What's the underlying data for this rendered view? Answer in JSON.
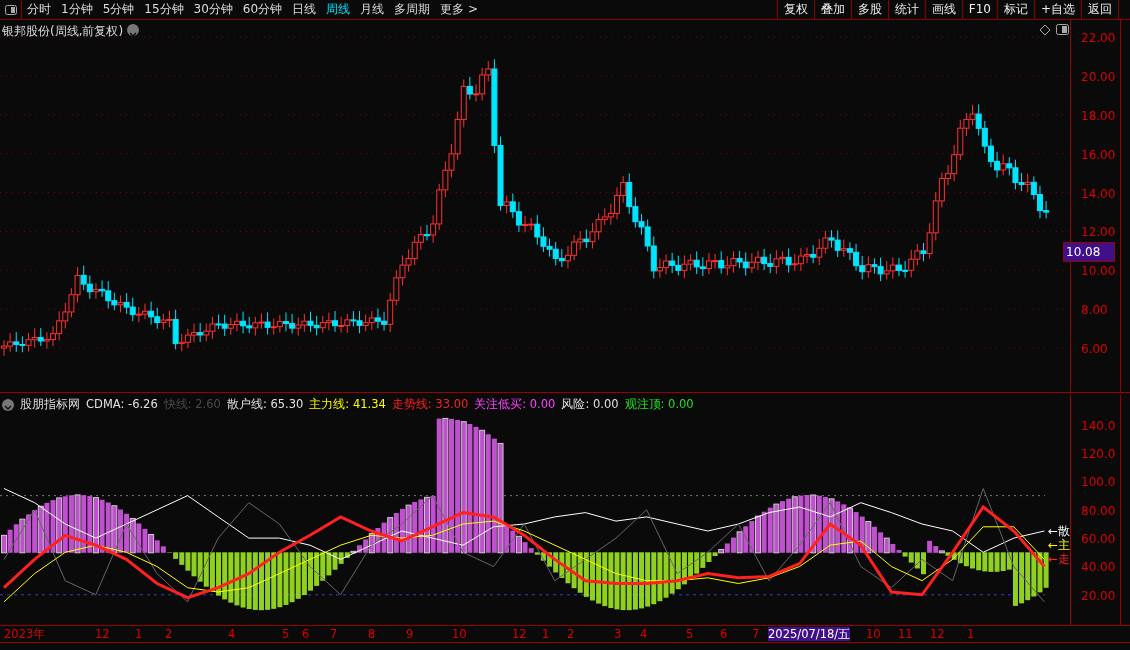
{
  "toolbar": {
    "periods": [
      {
        "label": "分时",
        "selected": false
      },
      {
        "label": "1分钟",
        "selected": false
      },
      {
        "label": "5分钟",
        "selected": false
      },
      {
        "label": "15分钟",
        "selected": false
      },
      {
        "label": "30分钟",
        "selected": false
      },
      {
        "label": "60分钟",
        "selected": false
      },
      {
        "label": "日线",
        "selected": false
      },
      {
        "label": "周线",
        "selected": true
      },
      {
        "label": "月线",
        "selected": false
      },
      {
        "label": "多周期",
        "selected": false
      },
      {
        "label": "更多 >",
        "selected": false
      }
    ],
    "actions": [
      "复权",
      "叠加",
      "多股",
      "统计",
      "画线",
      "F10",
      "标记",
      "+自选",
      "返回"
    ]
  },
  "main_chart": {
    "title": "银邦股份(周线,前复权)",
    "price_ticks": [
      "22.00",
      "20.00",
      "18.00",
      "16.00",
      "14.00",
      "12.00",
      "10.00",
      "8.00",
      "6.00"
    ],
    "current_price": "10.08"
  },
  "indicator": {
    "name": "股朋指标网",
    "legend": [
      {
        "label": "CDMA: -6.26",
        "color": "#e0e0e0"
      },
      {
        "label": "快线: 2.60",
        "color": "#4a4a4a"
      },
      {
        "label": "散户线: 65.30",
        "color": "#e0e0e0"
      },
      {
        "label": "主力线: 41.34",
        "color": "#ffff00"
      },
      {
        "label": "走势线: 33.00",
        "color": "#ff2020"
      },
      {
        "label": "关注低买: 0.00",
        "color": "#ff40ff"
      },
      {
        "label": "风险: 0.00",
        "color": "#e0e0e0"
      },
      {
        "label": "观注顶: 0.00",
        "color": "#20e020"
      }
    ],
    "chart_data": {
      "type": "line",
      "ylim": [
        -2,
        161
      ],
      "yticks": [
        {
          "value": 140,
          "label": "140.0"
        },
        {
          "value": 120,
          "label": "120.0"
        },
        {
          "value": 100,
          "label": "100.0"
        },
        {
          "value": 80,
          "label": "80.00"
        },
        {
          "value": 60,
          "label": "60.00"
        },
        {
          "value": 40,
          "label": "40.00"
        },
        {
          "value": 20,
          "label": "20.00"
        }
      ],
      "series": [
        {
          "color": "#ffffff",
          "values": [
            95,
            85,
            70,
            60,
            70,
            80,
            90,
            75,
            60,
            60,
            55,
            45,
            55,
            65,
            60,
            55,
            68,
            70,
            75,
            78,
            72,
            75,
            70,
            65,
            70,
            78,
            82,
            75,
            85,
            78,
            70,
            65,
            50,
            60,
            65
          ]
        },
        {
          "color": "#666666",
          "values": [
            45,
            80,
            30,
            20,
            70,
            35,
            15,
            60,
            85,
            70,
            40,
            20,
            55,
            70,
            90,
            50,
            40,
            70,
            30,
            45,
            60,
            80,
            35,
            50,
            70,
            30,
            55,
            85,
            40,
            25,
            45,
            30,
            95,
            40,
            15
          ]
        },
        {
          "color": "#ffff00",
          "values": [
            15,
            35,
            50,
            55,
            50,
            40,
            25,
            22,
            25,
            35,
            45,
            55,
            62,
            60,
            62,
            70,
            72,
            65,
            55,
            45,
            35,
            30,
            30,
            32,
            28,
            32,
            40,
            55,
            58,
            40,
            30,
            45,
            68,
            68,
            45
          ]
        },
        {
          "color": "#ff2020",
          "values": [
            25,
            45,
            62,
            55,
            45,
            28,
            18,
            25,
            35,
            50,
            62,
            75,
            65,
            58,
            68,
            78,
            75,
            62,
            45,
            30,
            28,
            28,
            30,
            35,
            32,
            33,
            42,
            70,
            55,
            22,
            20,
            50,
            82,
            65,
            40
          ]
        }
      ]
    },
    "line_tags": [
      {
        "label": "←散",
        "color": "#ffffff"
      },
      {
        "label": "←主",
        "color": "#ffff00"
      },
      {
        "label": "←走",
        "color": "#ff2020"
      }
    ]
  },
  "time_axis": {
    "labels": [
      {
        "label": "2023年",
        "selected": false
      },
      {
        "label": "12",
        "selected": false
      },
      {
        "label": "1",
        "selected": false
      },
      {
        "label": "2",
        "selected": false
      },
      {
        "label": "4",
        "selected": false
      },
      {
        "label": "5",
        "selected": false
      },
      {
        "label": "6",
        "selected": false
      },
      {
        "label": "7",
        "selected": false
      },
      {
        "label": "8",
        "selected": false
      },
      {
        "label": "9",
        "selected": false
      },
      {
        "label": "10",
        "selected": false
      },
      {
        "label": "12",
        "selected": false
      },
      {
        "label": "1",
        "selected": false
      },
      {
        "label": "2",
        "selected": false
      },
      {
        "label": "3",
        "selected": false
      },
      {
        "label": "4",
        "selected": false
      },
      {
        "label": "5",
        "selected": false
      },
      {
        "label": "6",
        "selected": false
      },
      {
        "label": "7",
        "selected": false
      },
      {
        "label": "2025/07/18/五",
        "selected": true
      },
      {
        "label": "10",
        "selected": false
      },
      {
        "label": "11",
        "selected": false
      },
      {
        "label": "12",
        "selected": false
      },
      {
        "label": "1",
        "selected": false
      }
    ]
  }
}
